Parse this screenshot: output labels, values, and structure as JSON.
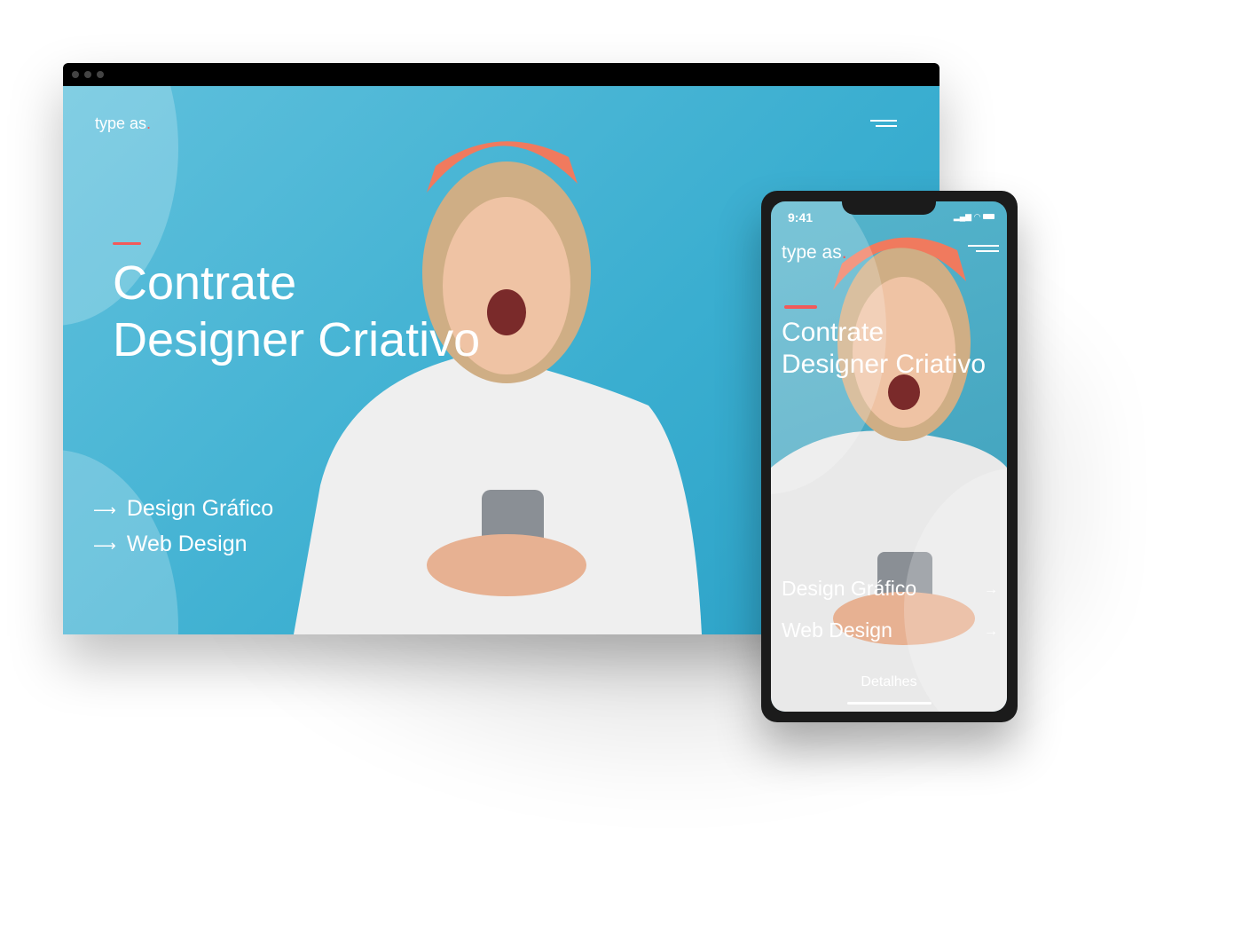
{
  "desktop": {
    "logo": "type as",
    "logo_dot": ".",
    "headline_line1": "Contrate",
    "headline_line2": "Designer Criativo",
    "links": [
      {
        "arrow": "⟶",
        "label": "Design Gráfico"
      },
      {
        "arrow": "⟶",
        "label": "Web Design"
      }
    ]
  },
  "mobile": {
    "time": "9:41",
    "logo": "type as",
    "logo_dot": ".",
    "headline_line1": "Contrate",
    "headline_line2": "Designer Criativo",
    "links": [
      {
        "arrow": "→",
        "label": "Design Gráfico"
      },
      {
        "arrow": "→",
        "label": "Web Design"
      }
    ],
    "details_button": "Detalhes"
  },
  "colors": {
    "accent": "#f25a5a",
    "background": "#3aaed0"
  }
}
